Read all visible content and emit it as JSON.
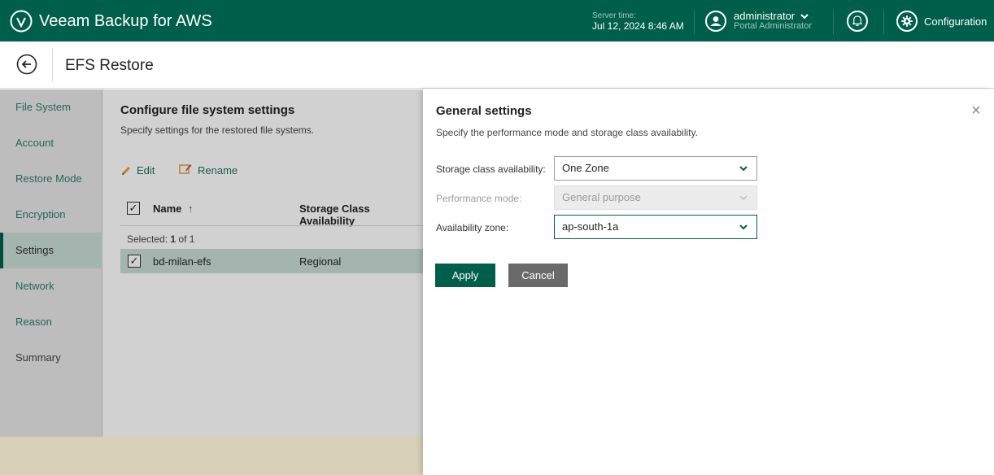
{
  "app": {
    "title": "Veeam Backup for AWS"
  },
  "topbar": {
    "server_time_label": "Server time:",
    "server_time_value": "Jul 12, 2024 8:46 AM",
    "user_name": "administrator",
    "user_role": "Portal Administrator",
    "config_label": "Configuration"
  },
  "page": {
    "title": "EFS Restore"
  },
  "nav": {
    "items": [
      {
        "label": "File System"
      },
      {
        "label": "Account"
      },
      {
        "label": "Restore Mode"
      },
      {
        "label": "Encryption"
      },
      {
        "label": "Settings"
      },
      {
        "label": "Network"
      },
      {
        "label": "Reason"
      },
      {
        "label": "Summary"
      }
    ],
    "active_index": 4
  },
  "main": {
    "title": "Configure file system settings",
    "subtitle": "Specify settings for the restored file systems.",
    "toolbar": {
      "edit": "Edit",
      "rename": "Rename"
    },
    "columns": {
      "name": "Name",
      "storage_class": "Storage Class Availability"
    },
    "sort_arrow": "↑",
    "selected_prefix": "Selected:",
    "selected_count": "1",
    "selected_suffix": "of 1",
    "rows": [
      {
        "name": "bd-milan-efs",
        "storage_class": "Regional"
      }
    ]
  },
  "panel": {
    "title": "General settings",
    "description": "Specify the performance mode and storage class availability.",
    "fields": {
      "storage_class": {
        "label": "Storage class availability:",
        "value": "One Zone"
      },
      "performance_mode": {
        "label": "Performance mode:",
        "value": "General purpose",
        "disabled": true
      },
      "availability_zone": {
        "label": "Availability zone:",
        "value": "ap-south-1a"
      }
    },
    "apply_label": "Apply",
    "cancel_label": "Cancel",
    "close_glyph": "×"
  },
  "colors": {
    "brand": "#005f4b",
    "active_row": "#c8dcd6",
    "nav_bg": "#e7e7e7",
    "footer_bg": "#d8d1b8"
  }
}
